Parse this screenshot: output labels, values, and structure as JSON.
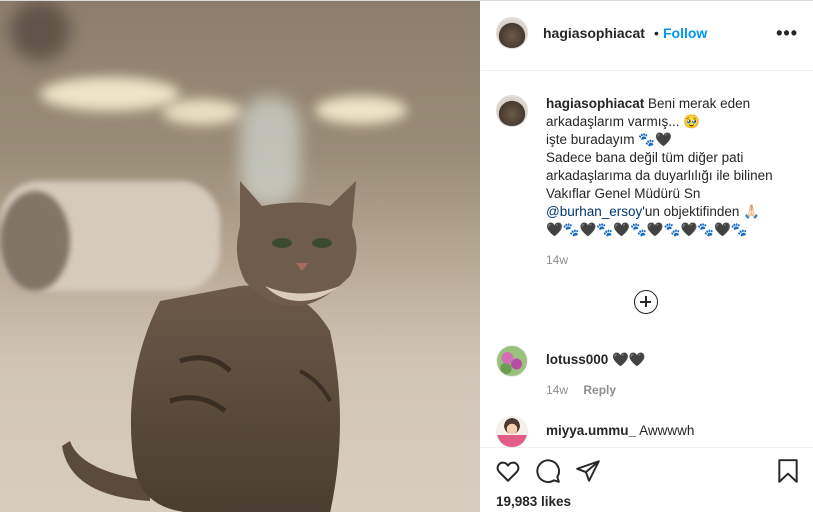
{
  "post": {
    "username": "hagiasophiacat",
    "separator": "•",
    "follow_label": "Follow",
    "more_label": "•••"
  },
  "caption": {
    "username": "hagiasophiacat",
    "lines": [
      "Beni merak eden",
      "arkadaşlarım varmış... 🥹",
      "işte buradayım 🐾🖤",
      "Sadece bana değil tüm diğer pati",
      "arkadaşlarıma da duyarlılığı ile bilinen",
      "Vakıflar Genel Müdürü Sn"
    ],
    "mention": "@burhan_ersoy",
    "mention_suffix": "'un objektifinden 🙏🏻",
    "last_line": "🖤🐾🖤🐾🖤🐾🖤🐾🖤🐾🖤🐾",
    "time": "14w"
  },
  "load_more_icon": "plus-circle-icon",
  "comments": [
    {
      "username": "lotuss000",
      "text": "🖤🖤",
      "time": "14w",
      "reply_label": "Reply"
    },
    {
      "username": "miyya.ummu_",
      "text": "Awwwwh"
    }
  ],
  "actions": {
    "icons": [
      "heart-icon",
      "comment-icon",
      "share-icon",
      "bookmark-icon"
    ],
    "likes": "19,983 likes"
  },
  "colors": {
    "accent": "#0095f6",
    "mention": "#00376b",
    "muted": "#8e8e8e"
  }
}
